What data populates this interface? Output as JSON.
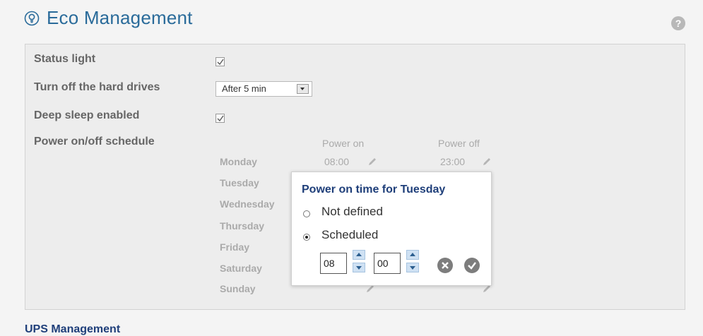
{
  "header": {
    "title": "Eco Management",
    "help_icon": "question-circle-icon",
    "title_icon": "eco-bulb-icon"
  },
  "settings": {
    "status_light": {
      "label": "Status light",
      "checked": true
    },
    "turn_off_drives": {
      "label": "Turn off the hard drives",
      "selected": "After 5 min"
    },
    "deep_sleep": {
      "label": "Deep sleep enabled",
      "checked": true
    },
    "schedule": {
      "label": "Power on/off schedule"
    }
  },
  "schedule_table": {
    "col_power_on": "Power on",
    "col_power_off": "Power off",
    "days": [
      "Monday",
      "Tuesday",
      "Wednesday",
      "Thursday",
      "Friday",
      "Saturday",
      "Sunday"
    ],
    "monday_on": "08:00",
    "monday_off": "23:00",
    "edit_icon": "pencil-icon"
  },
  "popup": {
    "title": "Power on time for Tuesday",
    "options": [
      "Not defined",
      "Scheduled"
    ],
    "selected_option": "Scheduled",
    "hour": "08",
    "minute": "00",
    "cancel_icon": "close-circle-icon",
    "confirm_icon": "check-circle-icon"
  },
  "footer": {
    "ups_label": "UPS Management"
  },
  "colors": {
    "accent": "#2a6b9a",
    "popup_title": "#1f3f7a",
    "panel_bg": "#ededed"
  }
}
